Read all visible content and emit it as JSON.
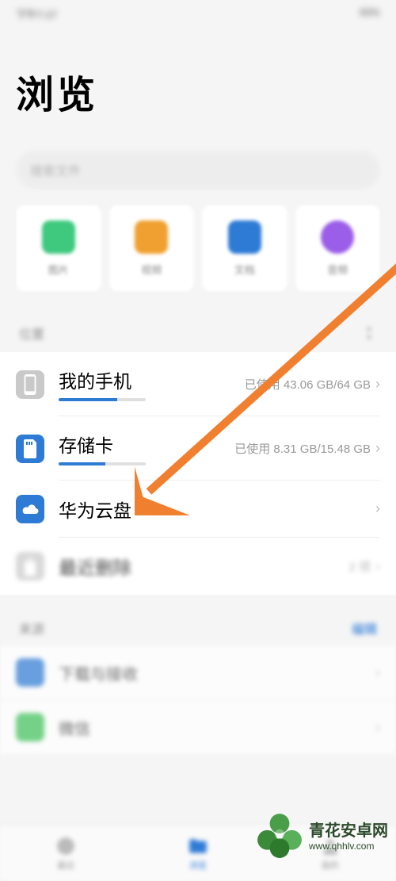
{
  "status": {
    "left": "下午7:17",
    "right": "93%"
  },
  "page": {
    "title": "浏览"
  },
  "search": {
    "placeholder": "搜索文件"
  },
  "categories": [
    {
      "label": "图片",
      "color": "#3fc97e"
    },
    {
      "label": "视频",
      "color": "#f0a030"
    },
    {
      "label": "文档",
      "color": "#2e7bd6"
    },
    {
      "label": "音频",
      "color": "#9a5ee8"
    }
  ],
  "location_section": {
    "label": "位置"
  },
  "storage": [
    {
      "name": "我的手机",
      "usage_text": "已使用 43.06 GB/64 GB",
      "fill_percent": 67,
      "icon_bg": "#c9c9c9",
      "blur": false
    },
    {
      "name": "存储卡",
      "usage_text": "已使用 8.31 GB/15.48 GB",
      "fill_percent": 54,
      "icon_bg": "#2e7bd6",
      "blur": false
    },
    {
      "name": "华为云盘",
      "usage_text": "",
      "fill_percent": null,
      "icon_bg": "#2e7bd6",
      "blur": false
    },
    {
      "name": "最近删除",
      "usage_text": "2 项",
      "fill_percent": null,
      "icon_bg": "#c9c9c9",
      "blur": true
    }
  ],
  "sources": {
    "label": "来源",
    "action": "编辑",
    "items": [
      {
        "name": "下载与接收",
        "count": "",
        "color": "#2e7bd6"
      },
      {
        "name": "微信",
        "count": "",
        "color": "#3fc35a"
      }
    ]
  },
  "nav": [
    {
      "label": "最近",
      "active": false
    },
    {
      "label": "浏览",
      "active": true
    },
    {
      "label": "我的",
      "active": false
    }
  ],
  "watermark": {
    "cn": "青花安卓网",
    "url": "www.qhhlv.com"
  }
}
